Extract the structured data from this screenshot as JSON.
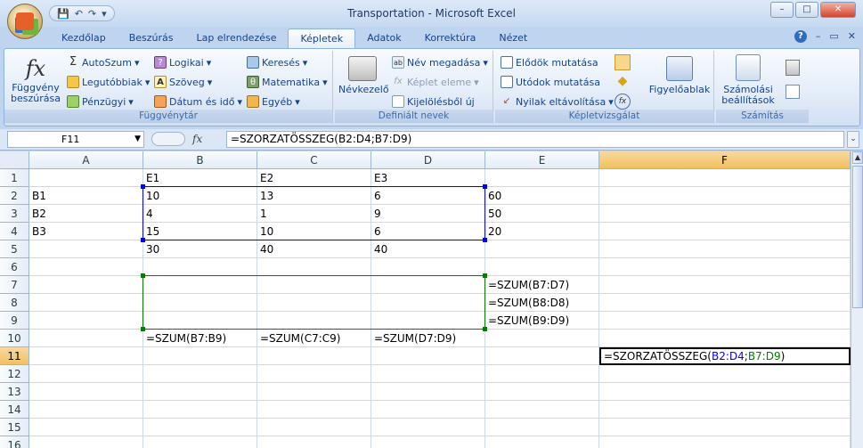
{
  "window": {
    "title": "Transportation - Microsoft Excel",
    "min": "–",
    "max": "□",
    "close": "✕"
  },
  "qat": {
    "save": "💾",
    "undo": "↶",
    "redo": "↷",
    "more": "▾"
  },
  "tabs": [
    {
      "label": "Kezdőlap",
      "active": false
    },
    {
      "label": "Beszúrás",
      "active": false
    },
    {
      "label": "Lap elrendezése",
      "active": false
    },
    {
      "label": "Képletek",
      "active": true
    },
    {
      "label": "Adatok",
      "active": false
    },
    {
      "label": "Korrektúra",
      "active": false
    },
    {
      "label": "Nézet",
      "active": false
    }
  ],
  "tabright": {
    "help": "?",
    "min": "–",
    "restore": "▭",
    "close": "✕"
  },
  "ribbon": {
    "fvtar": {
      "insert_line1": "Függvény",
      "insert_line2": "beszúrása",
      "autosum": "AutoSzum",
      "recent": "Legutóbbiak",
      "financial": "Pénzügyi",
      "logical": "Logikai",
      "text": "Szöveg",
      "datetime": "Dátum és idő",
      "lookup": "Keresés",
      "math": "Matematika",
      "more": "Egyéb",
      "label": "Függvénytár"
    },
    "names": {
      "manager": "Névkezelő",
      "define": "Név megadása",
      "use": "Képlet eleme",
      "create": "Kijelölésből új",
      "label": "Definiált nevek"
    },
    "audit": {
      "precedents": "Elődök mutatása",
      "dependents": "Utódok mutatása",
      "remove": "Nyilak eltávolítása",
      "watch": "Figyelőablak",
      "label": "Képletvizsgálat"
    },
    "calc": {
      "options_line1": "Számolási",
      "options_line2": "beállítások",
      "label": "Számítás"
    }
  },
  "formula_bar": {
    "name_box": "F11",
    "fx": "fx",
    "formula": "=SZORZATÖSSZEG(B2:D4;B7:D9)"
  },
  "columns": [
    "A",
    "B",
    "C",
    "D",
    "E",
    "F"
  ],
  "selected_column": "F",
  "selected_row": 11,
  "rows": [
    1,
    2,
    3,
    4,
    5,
    6,
    7,
    8,
    9,
    10,
    11,
    12,
    13,
    14,
    15,
    16
  ],
  "cells": {
    "B1": "E1",
    "C1": "E2",
    "D1": "E3",
    "A2": "B1",
    "B2": "10",
    "C2": "13",
    "D2": "6",
    "E2": "60",
    "A3": "B2",
    "B3": "4",
    "C3": "1",
    "D3": "9",
    "E3": "50",
    "A4": "B3",
    "B4": "15",
    "C4": "10",
    "D4": "6",
    "E4": "20",
    "B5": "30",
    "C5": "40",
    "D5": "40",
    "E7": "=SZUM(B7:D7)",
    "E8": "=SZUM(B8:D8)",
    "E9": "=SZUM(B9:D9)",
    "B10": "=SZUM(B7:B9)",
    "C10": "=SZUM(C7:C9)",
    "D10": "=SZUM(D7:D9)"
  },
  "edit_cell": {
    "prefix": "=SZORZATÖSSZEG(",
    "ref1": "B2:D4",
    "sep": ";",
    "ref2": "B7:D9",
    "suffix": ")"
  },
  "colors": {
    "ref_blue": "#0000ff",
    "ref_green": "#008000",
    "ribbon_text": "#15428b",
    "active_header": "#f1c15f"
  }
}
